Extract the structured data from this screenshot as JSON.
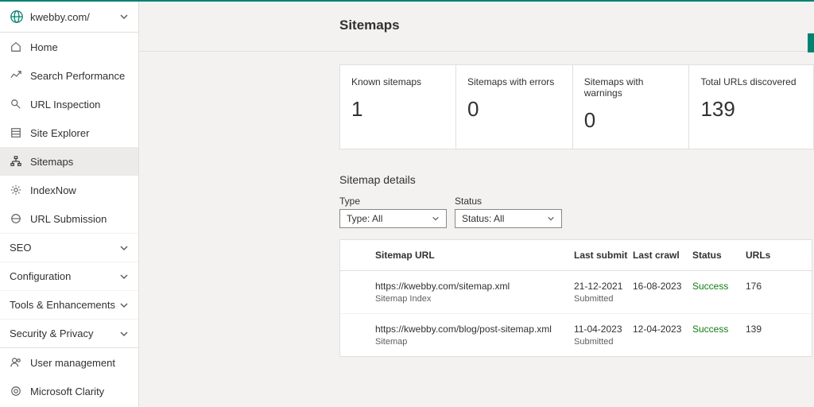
{
  "site": {
    "name": "kwebby.com/"
  },
  "nav": {
    "home": "Home",
    "search_perf": "Search Performance",
    "url_inspection": "URL Inspection",
    "site_explorer": "Site Explorer",
    "sitemaps": "Sitemaps",
    "indexnow": "IndexNow",
    "url_submission": "URL Submission",
    "user_mgmt": "User management",
    "clarity": "Microsoft Clarity"
  },
  "groups": {
    "seo": "SEO",
    "config": "Configuration",
    "tools": "Tools & Enhancements",
    "security": "Security & Privacy"
  },
  "page": {
    "title": "Sitemaps"
  },
  "stats": [
    {
      "label": "Known sitemaps",
      "value": "1"
    },
    {
      "label": "Sitemaps with errors",
      "value": "0"
    },
    {
      "label": "Sitemaps with warnings",
      "value": "0"
    },
    {
      "label": "Total URLs discovered",
      "value": "139"
    }
  ],
  "details": {
    "heading": "Sitemap details",
    "filters": {
      "type_label": "Type",
      "type_value": "Type: All",
      "status_label": "Status",
      "status_value": "Status: All"
    },
    "headers": {
      "url": "Sitemap URL",
      "last_submit": "Last submit",
      "last_crawl": "Last crawl",
      "status": "Status",
      "urls": "URLs"
    },
    "rows": [
      {
        "url": "https://kwebby.com/sitemap.xml",
        "kind": "Sitemap Index",
        "submit": "21-12-2021",
        "submit_sub": "Submitted",
        "crawl": "16-08-2023",
        "status": "Success",
        "urls": "176"
      },
      {
        "url": "https://kwebby.com/blog/post-sitemap.xml",
        "kind": "Sitemap",
        "submit": "11-04-2023",
        "submit_sub": "Submitted",
        "crawl": "12-04-2023",
        "status": "Success",
        "urls": "139"
      }
    ]
  }
}
